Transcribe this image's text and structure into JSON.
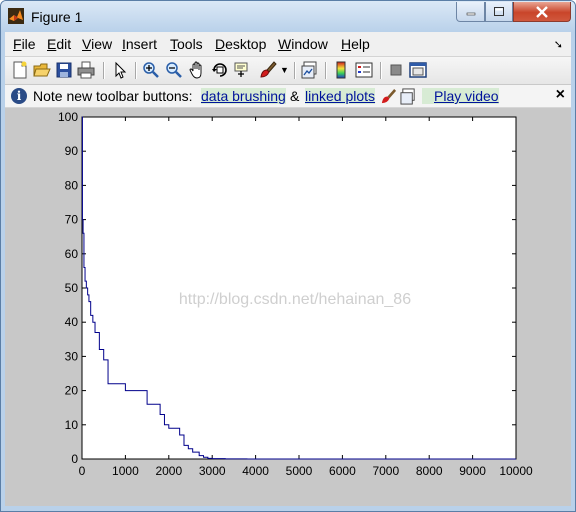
{
  "window": {
    "title": "Figure 1"
  },
  "menu": {
    "items": [
      {
        "label": "File",
        "u": "F",
        "rest": "ile"
      },
      {
        "label": "Edit",
        "u": "E",
        "rest": "dit"
      },
      {
        "label": "View",
        "u": "V",
        "rest": "iew"
      },
      {
        "label": "Insert",
        "u": "I",
        "rest": "nsert"
      },
      {
        "label": "Tools",
        "u": "T",
        "rest": "ools"
      },
      {
        "label": "Desktop",
        "u": "D",
        "rest": "esktop"
      },
      {
        "label": "Window",
        "u": "W",
        "rest": "indow"
      },
      {
        "label": "Help",
        "u": "H",
        "rest": "elp"
      }
    ]
  },
  "toolbar": {
    "icons": [
      "new-figure",
      "open-file",
      "save-figure",
      "print-figure",
      "edit-plot",
      "zoom-in",
      "zoom-out",
      "pan",
      "rotate-3d",
      "data-cursor",
      "brush",
      "brush-dropdown",
      "link-plot",
      "insert-colorbar",
      "insert-legend",
      "hide-plot-tools",
      "show-plot-tools"
    ]
  },
  "info": {
    "note": "Note new toolbar buttons:",
    "link1": "data brushing",
    "amp": "&",
    "link2": "linked plots",
    "link3": "Play video",
    "close": "×"
  },
  "watermark": "http://blog.csdn.net/hehainan_86",
  "chart_data": {
    "type": "line",
    "title": "",
    "xlabel": "",
    "ylabel": "",
    "xlim": [
      0,
      10000
    ],
    "ylim": [
      0,
      100
    ],
    "xticks": [
      0,
      1000,
      2000,
      3000,
      4000,
      5000,
      6000,
      7000,
      8000,
      9000,
      10000
    ],
    "yticks": [
      0,
      10,
      20,
      30,
      40,
      50,
      60,
      70,
      80,
      90,
      100
    ],
    "grid": false,
    "series": [
      {
        "color": "#00008b",
        "stairs": true,
        "x": [
          0,
          10,
          25,
          45,
          70,
          100,
          130,
          160,
          200,
          250,
          300,
          400,
          500,
          600,
          850,
          1000,
          1200,
          1500,
          1600,
          1800,
          1900,
          2000,
          2100,
          2250,
          2350,
          2450,
          2550,
          2700,
          2800,
          2900,
          3000,
          3300,
          3500,
          3800,
          3850,
          10000
        ],
        "y": [
          100,
          70,
          66,
          56,
          52,
          50,
          48,
          46,
          42,
          40,
          37,
          32,
          29,
          22,
          22,
          20,
          20,
          16,
          16,
          13,
          10,
          9,
          9,
          7,
          4,
          3,
          2,
          1,
          0.5,
          0.2,
          0.1,
          0.05,
          0.02,
          0.01,
          0,
          0
        ]
      }
    ]
  }
}
